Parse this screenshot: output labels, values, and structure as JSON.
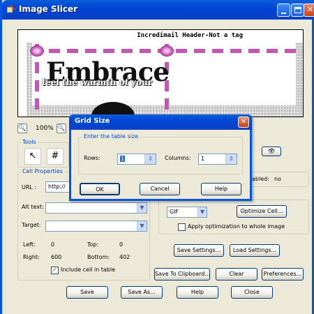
{
  "window": {
    "title": "Image Slicer"
  },
  "preview": {
    "header_text": "Incredimail Header-Not a tag",
    "embrace_text": "Embrace",
    "tagline_text": "feel the warmth of your"
  },
  "zoom": {
    "level": "100%"
  },
  "tools": {
    "label": "Tools"
  },
  "cell_properties": {
    "label": "Cell Properties",
    "url_label": "URL :",
    "url_value": "http://",
    "alt_label": "Alt text:",
    "target_label": "Target:",
    "left_label": "Left:",
    "left_value": "0",
    "top_label": "Top:",
    "top_value": "0",
    "right_label": "Right:",
    "right_value": "600",
    "bottom_label": "Bottom:",
    "bottom_value": "402",
    "include_label": "Include cell in table"
  },
  "partial_right": {
    "enabled_label": "abled:",
    "enabled_value": "no"
  },
  "optimize": {
    "format_value": "GIF",
    "optimize_button": "Optimize Cell...",
    "apply_label": "Apply optimization to whole image"
  },
  "buttons": {
    "save_settings": "Save Settings...",
    "load_settings": "Load Settings...",
    "save_clipboard": "Save To Clipboard...",
    "clear": "Clear",
    "preferences": "Preferences...",
    "save": "Save",
    "save_as": "Save As...",
    "help": "Help",
    "close": "Close"
  },
  "dialog": {
    "title": "Grid Size",
    "group_label": "Enter the table size",
    "rows_label": "Rows:",
    "rows_value": "1",
    "columns_label": "Columns:",
    "columns_value": "1",
    "ok": "OK",
    "cancel": "Cancel",
    "help": "Help"
  },
  "colors": {
    "titlebar": "#0046d5",
    "dialog_bg": "#ece9d8",
    "group_label": "#0046d5",
    "ribbon": "#c257b4"
  }
}
